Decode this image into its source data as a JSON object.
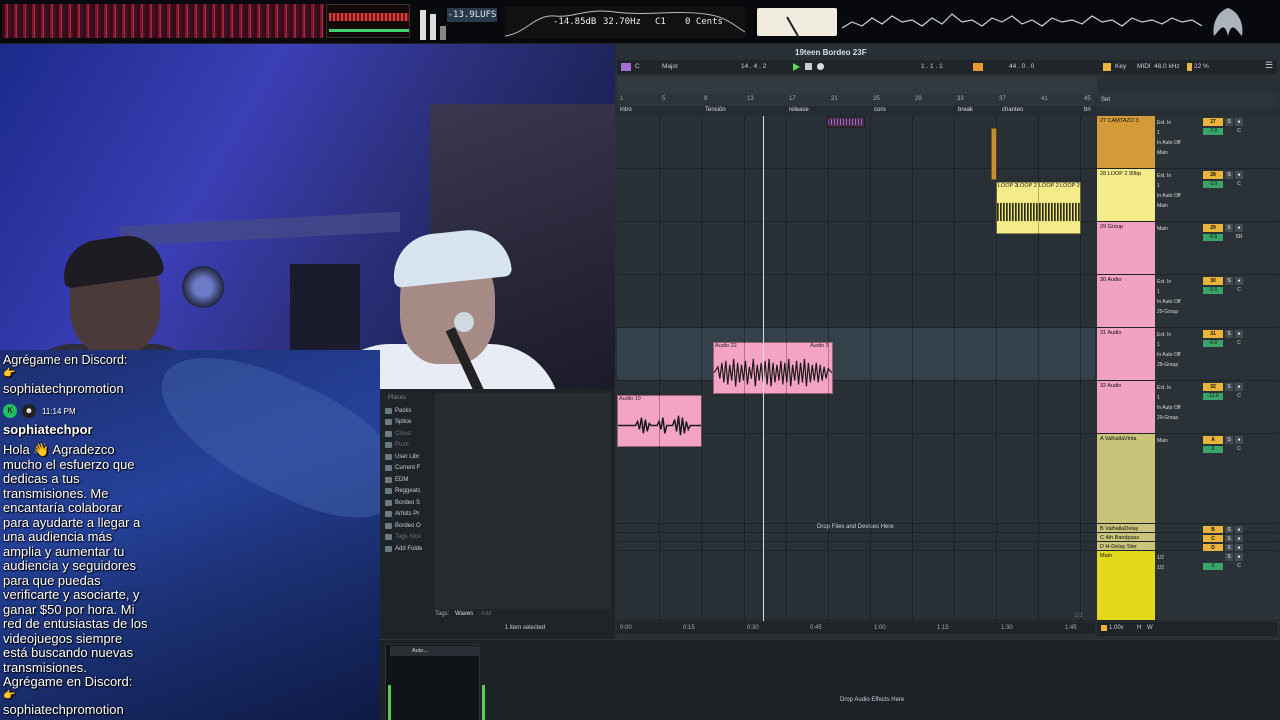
{
  "meters": {
    "lufs": "-13.9LUFS",
    "db": "-14.85dB",
    "freq": "32.70Hz",
    "note": "C1",
    "cents": "0 Cents"
  },
  "chat": {
    "prev_tail": "Agrégame en Discord:",
    "prev_emoji": "👉",
    "prev_link": "sophiatechpromotion",
    "time": "11:14 PM",
    "username": "sophiatechpor",
    "message": "Hola 👋 Agradezco mucho el esfuerzo que dedicas a tus transmisiones. Me encantaría colaborar para ayudarte a llegar a una audiencia más amplia y aumentar tu audiencia y seguidores para que puedas verificarte y asociarte, y ganar $50 por hora. Mi red de entusiastas de los videojuegos siempre está buscando nuevas transmisiones. Agrégame en Discord:",
    "emoji": "👉",
    "link": "sophiatechpromotion"
  },
  "browser": {
    "places_label": "Places",
    "places": [
      "Packs",
      "Splice",
      "Cloud",
      "Push",
      "User Libr",
      "Current F",
      "EDM",
      "Reggeatc",
      "Bordeo S",
      "Artists Pr",
      "Bordeo O",
      "Tags Nick",
      "Add Folde"
    ],
    "tags_label": "Tags:",
    "tags_value": "Waves",
    "tags_add": "Add",
    "selection": "1 item selected"
  },
  "device_strip": {
    "chain_title": "Auto...",
    "drop_label": "Drop Audio Effects Here"
  },
  "daw": {
    "title": "19teen Bordeo 23F",
    "key": "C",
    "scale": "Major",
    "tempo": "14 . 4 . 2",
    "position": "1 . 1 . 1",
    "loop_length": "44 . 0 . 0",
    "key_btn": "Key",
    "midi": "MIDI",
    "sample_rate": "48.0 kHz",
    "cpu": "22 %",
    "set_label": "Set",
    "ruler": [
      "1",
      "5",
      "9",
      "13",
      "17",
      "21",
      "25",
      "29",
      "33",
      "37",
      "41",
      "45"
    ],
    "locators": [
      "intro",
      "Tensión",
      "release",
      "coro",
      "break",
      "chanteo",
      "bri"
    ],
    "drop_files": "Drop Files and Devices Here",
    "time_ticks": [
      "0:00",
      "0:15",
      "0:30",
      "0:45",
      "1:00",
      "1:15",
      "1:30",
      "1:45"
    ],
    "page_counter": "1/1",
    "zoom": "1.00x",
    "footer_h": "H",
    "footer_w": "W"
  },
  "clips": {
    "audio22": "Audio 22",
    "audio3": "Audio 3",
    "audio10": "Audio 10",
    "loop": "LOOP 2",
    "loop_b": "LOOP 2",
    "loop_c": "LOOP 2",
    "loop_d": "LOOP 2"
  },
  "tracks": [
    {
      "name": "27 CAMTAZO 3",
      "color": "#d39a3a",
      "io": [
        "Ext. In",
        "1",
        "In Auto Off",
        "Main"
      ],
      "num": "27",
      "vol": "-7.0",
      "pan": "C"
    },
    {
      "name": "28 LOOP 2 90bp",
      "color": "#f4ec8a",
      "io": [
        "Ext. In",
        "1",
        "In Auto Off",
        "Main"
      ],
      "num": "28",
      "vol": "-3.0",
      "pan": "C"
    },
    {
      "name": "29 Group",
      "color": "#f1a2c0",
      "io": [
        "Main",
        "",
        "",
        ""
      ],
      "num": "29",
      "vol": "-6.6",
      "pan": "SR"
    },
    {
      "name": "30 Audio",
      "color": "#f1a2c0",
      "io": [
        "Ext. In",
        "1",
        "In Auto Off",
        "29-Group"
      ],
      "num": "30",
      "vol": "-5.0",
      "pan": "C"
    },
    {
      "name": "31 Audio",
      "color": "#f1a2c0",
      "io": [
        "Ext. In",
        "1",
        "In Auto Off",
        "29-Group"
      ],
      "num": "31",
      "vol": "-6.0",
      "pan": "C"
    },
    {
      "name": "32 Audio",
      "color": "#f1a2c0",
      "io": [
        "Ext. In",
        "1",
        "In Auto Off",
        "29-Group"
      ],
      "num": "32",
      "vol": "-12.0",
      "pan": "C"
    },
    {
      "name": "A ValhallaVinta",
      "color": "#c9c47a",
      "io": [
        "Main",
        "",
        "",
        ""
      ],
      "num": "A",
      "vol": "0",
      "pan": "C"
    },
    {
      "name": "B ValhallaDelay",
      "color": "#c9c47a",
      "io": [
        "",
        "",
        "",
        ""
      ],
      "num": "B",
      "vol": "",
      "pan": ""
    },
    {
      "name": "C 4th Bandpass",
      "color": "#c9c47a",
      "io": [
        "",
        "",
        "",
        ""
      ],
      "num": "C",
      "vol": "",
      "pan": ""
    },
    {
      "name": "D H-Delay Ster",
      "color": "#c9c47a",
      "io": [
        "",
        "",
        "",
        ""
      ],
      "num": "D",
      "vol": "",
      "pan": ""
    },
    {
      "name": "Main",
      "color": "#e4d91c",
      "io": [
        "1/2",
        "1/2",
        "",
        ""
      ],
      "num": "",
      "vol": "0",
      "pan": "C"
    }
  ]
}
